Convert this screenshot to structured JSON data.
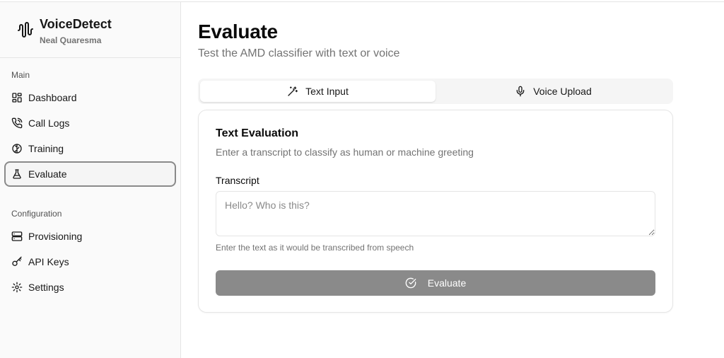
{
  "brand": {
    "name": "VoiceDetect",
    "user": "Neal Quaresma",
    "icon": "audio-waveform-icon"
  },
  "sidebar": {
    "groups": [
      {
        "label": "Main",
        "items": [
          {
            "label": "Dashboard",
            "icon": "layout-dashboard-icon",
            "active": false
          },
          {
            "label": "Call Logs",
            "icon": "phone-call-icon",
            "active": false
          },
          {
            "label": "Training",
            "icon": "brain-icon",
            "active": false
          },
          {
            "label": "Evaluate",
            "icon": "flask-icon",
            "active": true
          }
        ]
      },
      {
        "label": "Configuration",
        "items": [
          {
            "label": "Provisioning",
            "icon": "server-icon",
            "active": false
          },
          {
            "label": "API Keys",
            "icon": "key-icon",
            "active": false
          },
          {
            "label": "Settings",
            "icon": "gear-icon",
            "active": false
          }
        ]
      }
    ]
  },
  "page": {
    "title": "Evaluate",
    "subtitle": "Test the AMD classifier with text or voice"
  },
  "tabs": [
    {
      "label": "Text Input",
      "icon": "wand-sparkles-icon",
      "active": true
    },
    {
      "label": "Voice Upload",
      "icon": "microphone-icon",
      "active": false
    }
  ],
  "card": {
    "title": "Text Evaluation",
    "description": "Enter a transcript to classify as human or machine greeting",
    "field_label": "Transcript",
    "placeholder": "Hello? Who is this?",
    "value": "",
    "hint": "Enter the text as it would be transcribed from speech",
    "button_label": "Evaluate",
    "button_icon": "circle-check-icon"
  },
  "colors": {
    "sidebar_bg": "#fafafa",
    "active_border": "#8a8a8a",
    "button_disabled": "#8a8a8a",
    "muted_text": "#737373",
    "border": "#e5e5e5"
  }
}
